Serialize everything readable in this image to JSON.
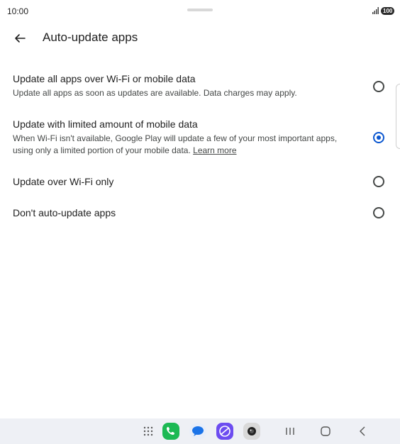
{
  "status_bar": {
    "time": "10:00",
    "battery": "100"
  },
  "header": {
    "title": "Auto-update apps",
    "back_icon": "arrow-back-icon"
  },
  "options": [
    {
      "title": "Update all apps over Wi-Fi or mobile data",
      "description": "Update all apps as soon as updates are available. Data charges may apply.",
      "selected": false
    },
    {
      "title": "Update with limited amount of mobile data",
      "description": "When Wi-Fi isn't available, Google Play will update a few of your most important apps, using only a limited portion of your mobile data.",
      "link": "Learn more",
      "selected": true
    },
    {
      "title": "Update over Wi-Fi only",
      "selected": false
    },
    {
      "title": "Don't auto-update apps",
      "selected": false
    }
  ],
  "nav_bar": {
    "items": [
      "apps-grid-icon",
      "phone-icon",
      "messages-icon",
      "browser-icon",
      "camera-icon",
      "recents-icon",
      "home-icon",
      "back-icon"
    ]
  },
  "colors": {
    "accent": "#0b57d0",
    "nav_bg": "#eef0f5"
  }
}
